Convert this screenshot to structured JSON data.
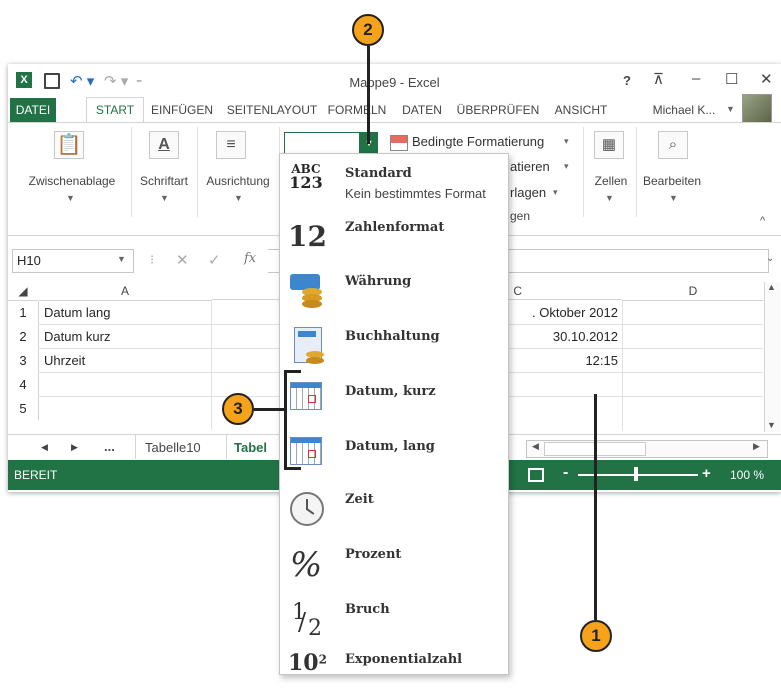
{
  "window": {
    "title": "Mappe9 - Excel",
    "help": "?",
    "restore_ribbon": "⊼",
    "minimize": "–",
    "maximize": "☐",
    "close": "✕"
  },
  "quick_access": {
    "undo": "↶ ▾",
    "redo": "↷ ▾",
    "customize": "₌"
  },
  "tabs": [
    "DATEI",
    "START",
    "EINFÜGEN",
    "SEITENLAYOUT",
    "FORMELN",
    "DATEN",
    "ÜBERPRÜFEN",
    "ANSICHT"
  ],
  "user": "Michael K...",
  "ribbon": {
    "groups": [
      "Zwischenablage",
      "Schriftart",
      "Ausrichtung"
    ],
    "number_format_value": "",
    "cond_format": "Bedingte Formatierung",
    "table_format_partial": "atieren",
    "cell_styles_partial": "rlagen",
    "styles_group_partial": "gen",
    "cells": "Zellen",
    "edit": "Bearbeiten"
  },
  "formula_bar": {
    "name_box": "H10",
    "fx": "fx"
  },
  "columns": [
    "A",
    "C",
    "D"
  ],
  "rows": [
    {
      "num": "1",
      "a": "Datum lang",
      "c": ". Oktober 2012"
    },
    {
      "num": "2",
      "a": "Datum kurz",
      "c": "30.10.2012"
    },
    {
      "num": "3",
      "a": "Uhrzeit",
      "c": "12:15"
    },
    {
      "num": "4",
      "a": "",
      "c": ""
    },
    {
      "num": "5",
      "a": "",
      "c": ""
    }
  ],
  "sheet_tabs": {
    "ellipsis": "...",
    "tab1": "Tabelle10",
    "tab2": "Tabel"
  },
  "status": {
    "ready": "BEREIT",
    "zoom": "100 %",
    "minus": "-",
    "plus": "+"
  },
  "menu_items": [
    {
      "title": "Standard",
      "sub": "Kein bestimmtes Format",
      "icon": "abc-123-icon"
    },
    {
      "title": "Zahlenformat",
      "icon": "number-12-icon"
    },
    {
      "title": "Währung",
      "icon": "currency-icon"
    },
    {
      "title": "Buchhaltung",
      "icon": "accounting-icon"
    },
    {
      "title": "Datum, kurz",
      "icon": "calendar-short-icon"
    },
    {
      "title": "Datum, lang",
      "icon": "calendar-long-icon"
    },
    {
      "title": "Zeit",
      "icon": "clock-icon"
    },
    {
      "title": "Prozent",
      "icon": "percent-icon"
    },
    {
      "title": "Bruch",
      "icon": "fraction-icon"
    },
    {
      "title": "Exponentialzahl",
      "icon": "exponent-icon"
    }
  ],
  "menu_icon_text": {
    "abc": "ABC",
    "n123": "123",
    "twelve": "12",
    "percent": "%",
    "half_num": "1",
    "half_den": "2",
    "ten": "10",
    "sq": "2"
  },
  "callouts": [
    "1",
    "2",
    "3"
  ],
  "colors": {
    "excel_green": "#217346",
    "callout": "#f6a31b"
  }
}
